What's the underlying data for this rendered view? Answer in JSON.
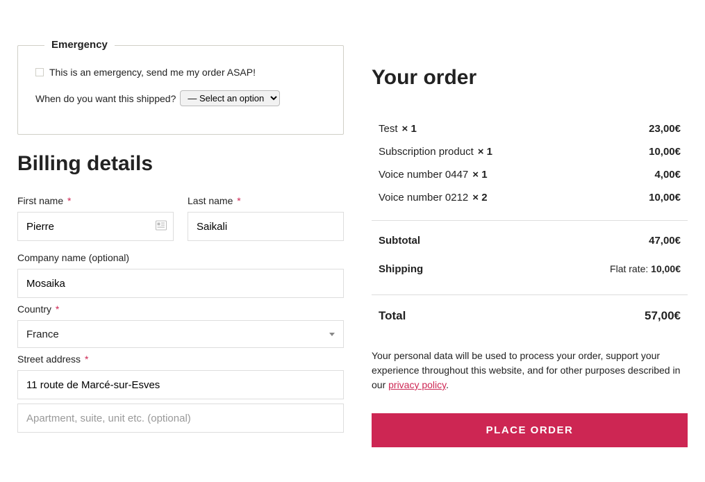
{
  "emergency": {
    "legend": "Emergency",
    "checkbox_label": "This is an emergency, send me my order ASAP!",
    "ship_question": "When do you want this shipped?",
    "select_placeholder": "— Select an option"
  },
  "billing": {
    "heading": "Billing details",
    "first_name": {
      "label": "First name",
      "value": "Pierre",
      "required": "*"
    },
    "last_name": {
      "label": "Last name",
      "value": "Saikali",
      "required": "*"
    },
    "company": {
      "label": "Company name (optional)",
      "value": "Mosaika"
    },
    "country": {
      "label": "Country",
      "value": "France",
      "required": "*"
    },
    "street": {
      "label": "Street address",
      "value": "11 route de Marcé-sur-Esves",
      "required": "*"
    },
    "apt_placeholder": "Apartment, suite, unit etc. (optional)"
  },
  "order": {
    "heading": "Your order",
    "items": [
      {
        "name": "Test",
        "qty": "× 1",
        "price": "23,00€"
      },
      {
        "name": "Subscription product",
        "qty": "× 1",
        "price": "10,00€"
      },
      {
        "name": "Voice number 0447",
        "qty": "× 1",
        "price": "4,00€"
      },
      {
        "name": "Voice number 0212",
        "qty": "× 2",
        "price": "10,00€"
      }
    ],
    "subtotal_label": "Subtotal",
    "subtotal_value": "47,00€",
    "shipping_label": "Shipping",
    "shipping_rate_label": "Flat rate:",
    "shipping_rate_value": "10,00€",
    "total_label": "Total",
    "total_value": "57,00€",
    "disclaimer_pre": "Your personal data will be used to process your order, support your experience throughout this website, and for other purposes described in our ",
    "privacy_link": "privacy policy",
    "disclaimer_post": ".",
    "place_order": "PLACE ORDER"
  }
}
